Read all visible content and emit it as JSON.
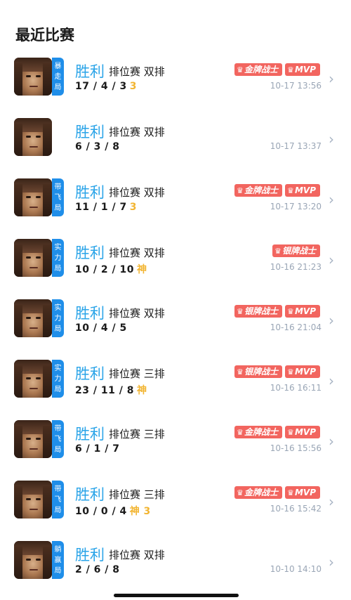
{
  "page": {
    "title": "最近比赛"
  },
  "matches": [
    {
      "tag": [
        "暴",
        "走",
        "局"
      ],
      "result": "胜利",
      "mode": "排位赛 双排",
      "kda": "17 / 4 / 3",
      "extra": "3",
      "badges": [
        "金牌战士",
        "MVP"
      ],
      "time": "10-17 13:56"
    },
    {
      "tag": [],
      "result": "胜利",
      "mode": "排位赛 双排",
      "kda": "6 / 3 / 8",
      "extra": "",
      "badges": [],
      "time": "10-17 13:37"
    },
    {
      "tag": [
        "带",
        "飞",
        "局"
      ],
      "result": "胜利",
      "mode": "排位赛 双排",
      "kda": "11 / 1 / 7",
      "extra": "3",
      "badges": [
        "金牌战士",
        "MVP"
      ],
      "time": "10-17 13:20"
    },
    {
      "tag": [
        "实",
        "力",
        "局"
      ],
      "result": "胜利",
      "mode": "排位赛 双排",
      "kda": "10 / 2 / 10",
      "extra": "神",
      "badges": [
        "银牌战士"
      ],
      "time": "10-16 21:23"
    },
    {
      "tag": [
        "实",
        "力",
        "局"
      ],
      "result": "胜利",
      "mode": "排位赛 双排",
      "kda": "10 / 4 / 5",
      "extra": "",
      "badges": [
        "银牌战士",
        "MVP"
      ],
      "time": "10-16 21:04"
    },
    {
      "tag": [
        "实",
        "力",
        "局"
      ],
      "result": "胜利",
      "mode": "排位赛 三排",
      "kda": "23 / 11 / 8",
      "extra": "神",
      "badges": [
        "银牌战士",
        "MVP"
      ],
      "time": "10-16 16:11"
    },
    {
      "tag": [
        "带",
        "飞",
        "局"
      ],
      "result": "胜利",
      "mode": "排位赛 三排",
      "kda": "6 / 1 / 7",
      "extra": "",
      "badges": [
        "金牌战士",
        "MVP"
      ],
      "time": "10-16 15:56"
    },
    {
      "tag": [
        "带",
        "飞",
        "局"
      ],
      "result": "胜利",
      "mode": "排位赛 三排",
      "kda": "10 / 0 / 4",
      "extra": "神 3",
      "badges": [
        "金牌战士",
        "MVP"
      ],
      "time": "10-16 15:42"
    },
    {
      "tag": [
        "躺",
        "赢",
        "局"
      ],
      "result": "胜利",
      "mode": "排位赛 双排",
      "kda": "2 / 6 / 8",
      "extra": "",
      "badges": [],
      "time": "10-10 14:10"
    }
  ],
  "icons": {
    "chevron": "chevron-right-icon",
    "badge_mark": "trophy-icon",
    "avatar": "hero-portrait"
  },
  "colors": {
    "result": "#2aa4e8",
    "tag_bg": "#1f8ee9",
    "badge_bg": "#f2655f",
    "extra": "#f2b532",
    "time": "#9aa6b6"
  }
}
